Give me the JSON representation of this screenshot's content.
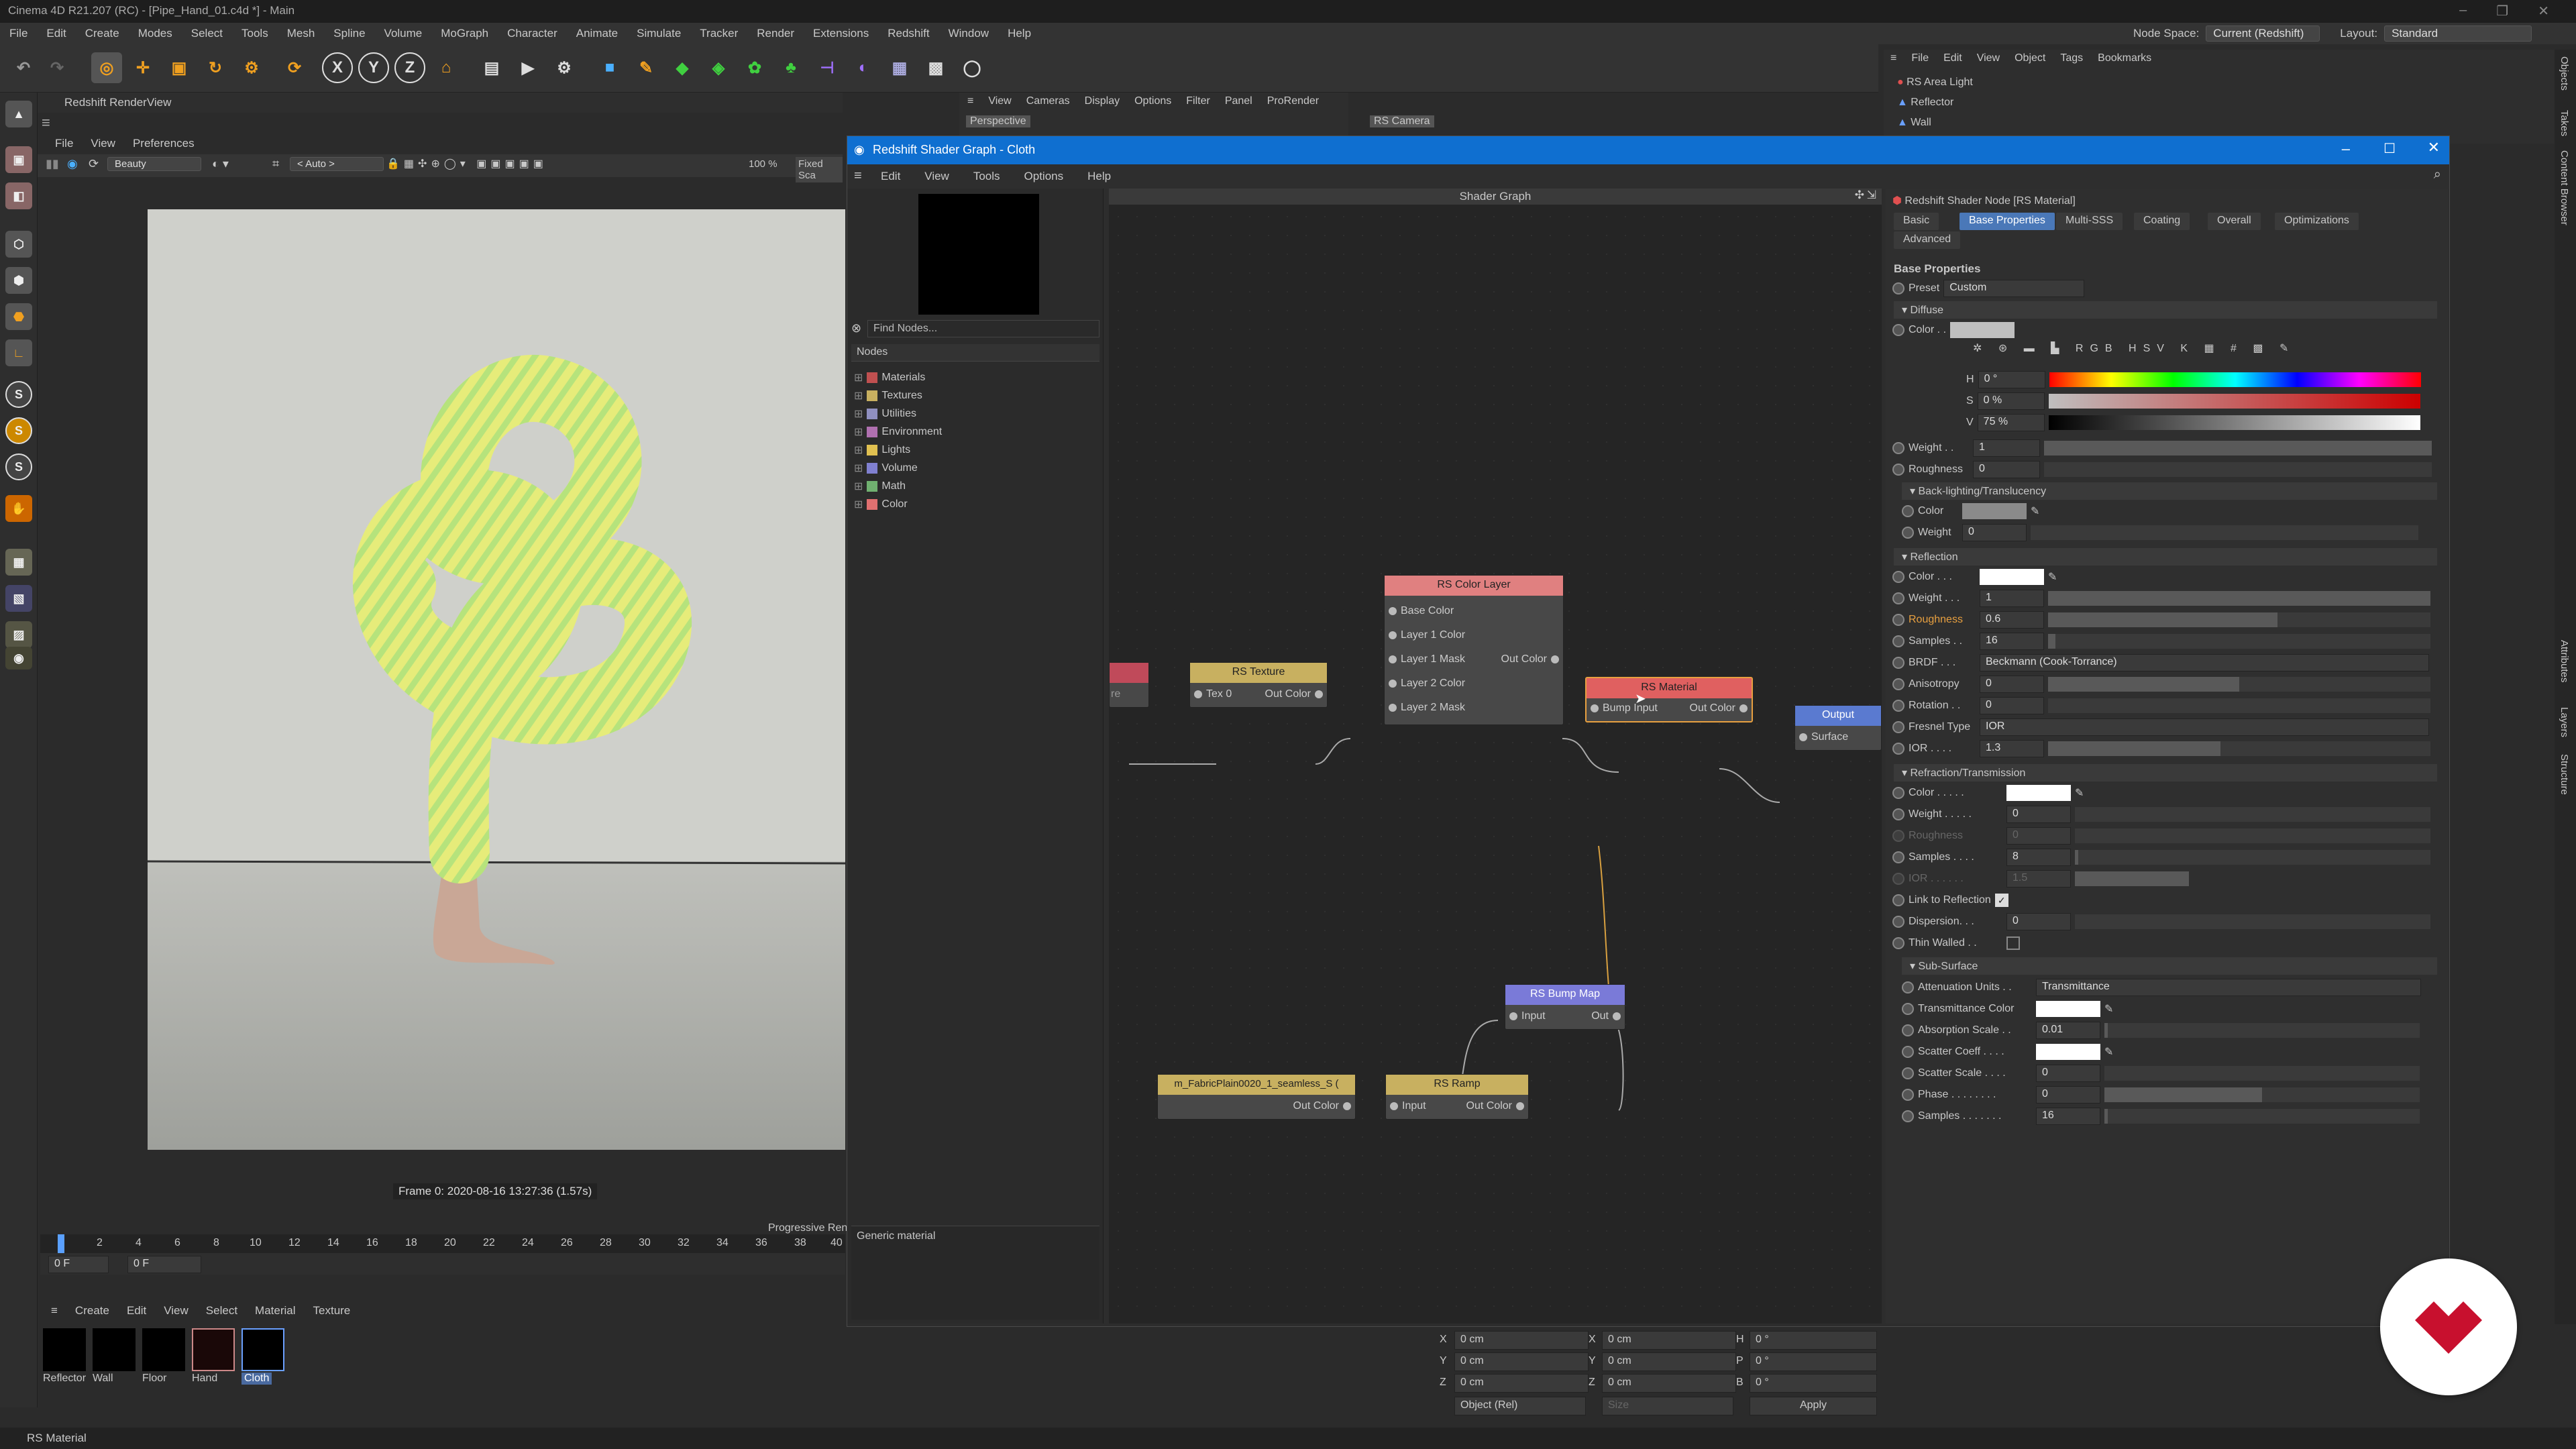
{
  "app": {
    "title": "Cinema 4D R21.207 (RC) - [Pipe_Hand_01.c4d *] - Main",
    "window_controls": [
      "–",
      "❐",
      "✕"
    ]
  },
  "menubar": {
    "items": [
      "File",
      "Edit",
      "Create",
      "Modes",
      "Select",
      "Tools",
      "Mesh",
      "Spline",
      "Volume",
      "MoGraph",
      "Character",
      "Animate",
      "Simulate",
      "Tracker",
      "Render",
      "Extensions",
      "Redshift",
      "Window",
      "Help"
    ],
    "node_space_label": "Node Space:",
    "node_space_value": "Current (Redshift)",
    "layout_label": "Layout:",
    "layout_value": "Standard"
  },
  "renderview": {
    "title": "Redshift RenderView",
    "menu": [
      "File",
      "View",
      "Preferences"
    ],
    "aov": "Beauty",
    "auto": "< Auto >",
    "zoom": "100 %",
    "fixed": "Fixed Sca",
    "frame_info": "Frame  0:  2020-08-16  13:27:36  (1.57s)",
    "progressive": "Progressive Rend"
  },
  "timeline": {
    "ticks": [
      "0",
      "2",
      "4",
      "6",
      "8",
      "10",
      "12",
      "14",
      "16",
      "18",
      "20",
      "22",
      "24",
      "26",
      "28",
      "30",
      "32",
      "34",
      "36",
      "38",
      "40"
    ],
    "current": "0 F",
    "end": "0 F"
  },
  "material_manager": {
    "menu": [
      "Create",
      "Edit",
      "View",
      "Select",
      "Material",
      "Texture"
    ],
    "materials": [
      {
        "name": "Reflector",
        "selected": false
      },
      {
        "name": "Wall",
        "selected": false
      },
      {
        "name": "Floor",
        "selected": false
      },
      {
        "name": "Hand",
        "selected": false
      },
      {
        "name": "Cloth",
        "selected": true
      }
    ]
  },
  "status": "RS Material",
  "object_manager": {
    "menu": [
      "File",
      "Edit",
      "View",
      "Object",
      "Tags",
      "Bookmarks"
    ],
    "objects": [
      "RS Area Light",
      "Reflector",
      "Wall"
    ]
  },
  "viewport_header": {
    "menu": [
      "View",
      "Cameras",
      "Display",
      "Options",
      "Filter",
      "Panel",
      "ProRender"
    ],
    "perspective": "Perspective",
    "camera": "RS Camera"
  },
  "right_tabs": [
    "Objects",
    "Takes",
    "Content Browser",
    "Attributes",
    "Layers",
    "Structure"
  ],
  "shader_graph": {
    "title": "Redshift Shader Graph - Cloth",
    "menu": [
      "Edit",
      "View",
      "Tools",
      "Options",
      "Help"
    ],
    "find_placeholder": "Find Nodes...",
    "nodes_header": "Nodes",
    "categories": [
      {
        "name": "Materials",
        "color": "#c05050"
      },
      {
        "name": "Textures",
        "color": "#c8b060"
      },
      {
        "name": "Utilities",
        "color": "#9090c0"
      },
      {
        "name": "Environment",
        "color": "#b070b0"
      },
      {
        "name": "Lights",
        "color": "#e0c050"
      },
      {
        "name": "Volume",
        "color": "#8080d0"
      },
      {
        "name": "Math",
        "color": "#70b070"
      },
      {
        "name": "Color",
        "color": "#e07070"
      }
    ],
    "description": "Generic material",
    "graph_title": "Shader Graph",
    "nodes": {
      "color_layer": {
        "title": "RS Color Layer",
        "inputs": [
          "Base Color",
          "Layer 1 Color",
          "Layer 1 Mask",
          "Layer 2 Color",
          "Layer 2 Mask"
        ],
        "output": "Out Color"
      },
      "texture": {
        "title": "RS Texture",
        "input": "Tex 0",
        "output": "Out Color"
      },
      "material": {
        "title": "RS Material",
        "input": "Bump Input",
        "output": "Out Color"
      },
      "output": {
        "title": "Output",
        "input": "Surface"
      },
      "bump": {
        "title": "RS Bump Map",
        "input": "Input",
        "output": "Out"
      },
      "fabric": {
        "title": "m_FabricPlain0020_1_seamless_S (",
        "output": "Out Color"
      },
      "ramp": {
        "title": "RS Ramp",
        "input": "Input",
        "output": "Out Color"
      },
      "partial": {
        "input": "re"
      }
    },
    "attributes": {
      "header": "Redshift Shader Node [RS Material]",
      "tabs": [
        "Basic",
        "Base Properties",
        "Multi-SSS",
        "Coating",
        "Overall",
        "Optimizations",
        "Advanced"
      ],
      "active_tab": "Base Properties",
      "section": "Base Properties",
      "preset_label": "Preset",
      "preset": "Custom",
      "diffuse": {
        "title": "Diffuse",
        "color_label": "Color . .",
        "h": "0 °",
        "s": "0 %",
        "v": "75 %",
        "weight_label": "Weight . .",
        "weight": "1",
        "roughness_label": "Roughness",
        "roughness": "0"
      },
      "backlight": {
        "title": "Back-lighting/Translucency",
        "color_label": "Color",
        "weight_label": "Weight",
        "weight": "0"
      },
      "reflection": {
        "title": "Reflection",
        "color_label": "Color . . .",
        "weight_label": "Weight . . .",
        "weight": "1",
        "roughness_label": "Roughness",
        "roughness": "0.6",
        "samples_label": "Samples . .",
        "samples": "16",
        "brdf_label": "BRDF . . .",
        "brdf": "Beckmann (Cook-Torrance)",
        "aniso_label": "Anisotropy",
        "aniso": "0",
        "rotation_label": "Rotation . .",
        "rotation": "0",
        "fresnel_label": "Fresnel Type",
        "fresnel": "IOR",
        "ior_label": "IOR . . . .",
        "ior": "1.3"
      },
      "refraction": {
        "title": "Refraction/Transmission",
        "color_label": "Color . . . . .",
        "weight_label": "Weight . . . . .",
        "weight": "0",
        "roughness_label": "Roughness",
        "roughness": "0",
        "samples_label": "Samples . . . .",
        "samples": "8",
        "ior_label": "IOR . . . . . .",
        "ior": "1.5",
        "link_label": "Link to Reflection",
        "dispersion_label": "Dispersion. . .",
        "dispersion": "0",
        "thin_label": "Thin Walled . .  "
      },
      "subsurface": {
        "title": "Sub-Surface",
        "atten_label": "Attenuation Units . .",
        "atten": "Transmittance",
        "trans_label": "Transmittance Color",
        "absorb_label": "Absorption Scale . .",
        "absorb": "0.01",
        "scatter_label": "Scatter Coeff . . . .",
        "scale_label": "Scatter Scale . . . .",
        "scale": "0",
        "phase_label": "Phase . . . . . . . .",
        "phase": "0",
        "samples_label": "Samples . . . . . . .",
        "samples": "16"
      }
    }
  },
  "coords": {
    "x": "0 cm",
    "y": "0 cm",
    "z": "0 cm",
    "sx": "0 cm",
    "sy": "0 cm",
    "sz": "0 cm",
    "h": "0 °",
    "p": "0 °",
    "b": "0 °",
    "mode": "Object (Rel)",
    "size": "Size",
    "apply": "Apply"
  }
}
